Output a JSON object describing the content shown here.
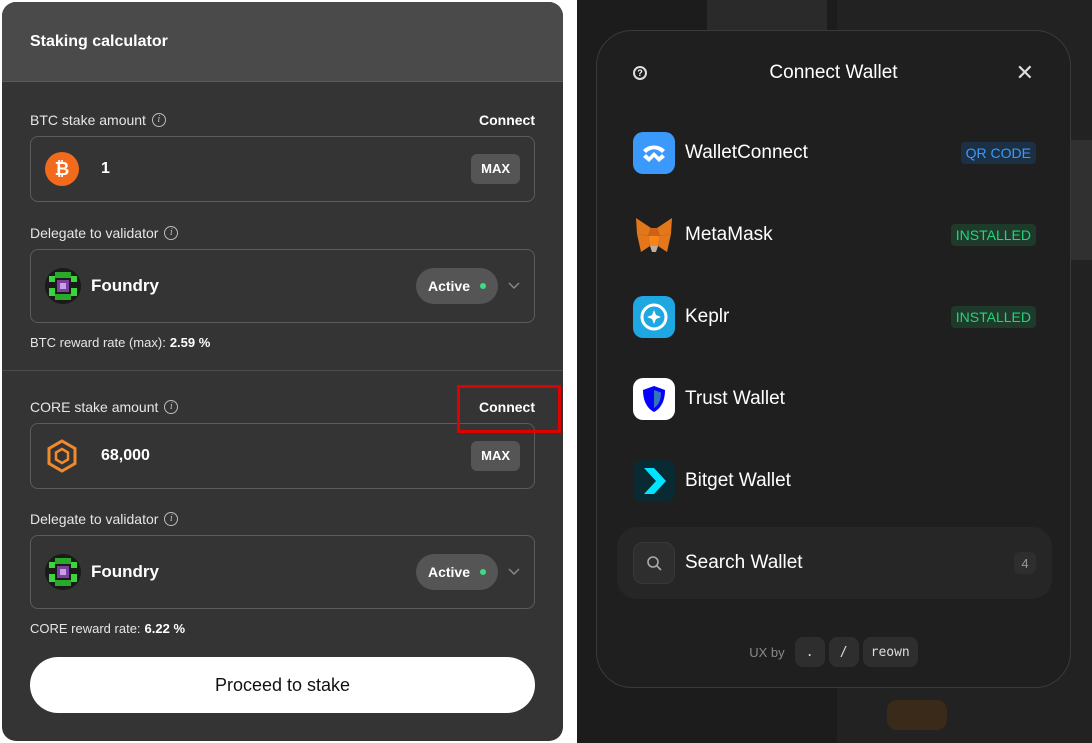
{
  "calculator": {
    "title": "Staking calculator",
    "btc": {
      "label": "BTC stake amount",
      "connect": "Connect",
      "amount": "1",
      "max": "MAX",
      "delegate_label": "Delegate to validator",
      "validator": "Foundry",
      "status": "Active",
      "rate_label": "BTC reward rate (max):",
      "rate_value": "2.59 %"
    },
    "core": {
      "label": "CORE stake amount",
      "connect": "Connect",
      "amount": "68,000",
      "max": "MAX",
      "delegate_label": "Delegate to validator",
      "validator": "Foundry",
      "status": "Active",
      "rate_label": "CORE reward rate:",
      "rate_value": "6.22 %"
    },
    "proceed": "Proceed to stake",
    "colors": {
      "btc": "#f26b1d",
      "core": "#f08a2c",
      "status_dot": "#3ddc84",
      "highlight": "#e00000"
    }
  },
  "modal": {
    "title": "Connect Wallet",
    "wallets": [
      {
        "name": "WalletConnect",
        "tag": "QR CODE",
        "icon": "walletconnect-icon"
      },
      {
        "name": "MetaMask",
        "tag": "INSTALLED",
        "icon": "metamask-fox-icon"
      },
      {
        "name": "Keplr",
        "tag": "INSTALLED",
        "icon": "keplr-icon"
      },
      {
        "name": "Trust Wallet",
        "tag": "",
        "icon": "trust-shield-icon"
      },
      {
        "name": "Bitget Wallet",
        "tag": "",
        "icon": "bitget-icon"
      }
    ],
    "search": {
      "label": "Search Wallet",
      "count": "4"
    },
    "footer": {
      "ux_by": "UX by",
      "chip1": ".",
      "chip2": "/",
      "chip3": "reown"
    }
  }
}
